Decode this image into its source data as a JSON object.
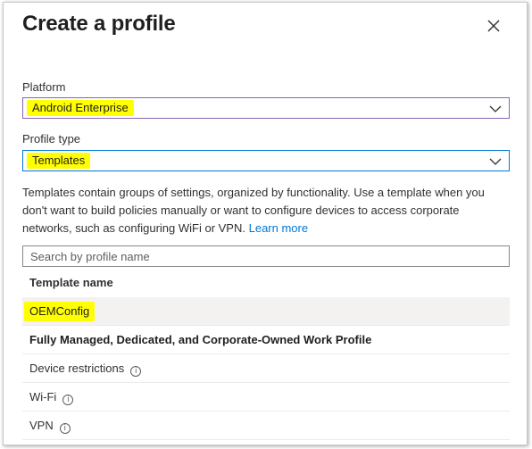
{
  "dialog": {
    "title": "Create a profile",
    "close_icon": "close-icon"
  },
  "platform": {
    "label": "Platform",
    "value": "Android Enterprise"
  },
  "profile_type": {
    "label": "Profile type",
    "value": "Templates"
  },
  "description": {
    "text": "Templates contain groups of settings, organized by functionality. Use a template when you don't want to build policies manually or want to configure devices to access corporate networks, such as configuring WiFi or VPN.",
    "link": "Learn more"
  },
  "search": {
    "placeholder": "Search by profile name"
  },
  "table": {
    "column_header": "Template name",
    "rows": [
      {
        "label": "OEMConfig",
        "selected": true
      },
      {
        "label": "Fully Managed, Dedicated, and Corporate-Owned Work Profile",
        "group": true
      },
      {
        "label": "Device restrictions",
        "info": true
      },
      {
        "label": "Wi-Fi",
        "info": true
      },
      {
        "label": "VPN",
        "info": true
      }
    ]
  },
  "colors": {
    "highlight": "#ffff00",
    "link": "#0078d4",
    "focus_border": "#0078d4",
    "platform_border": "#8a63b8"
  }
}
